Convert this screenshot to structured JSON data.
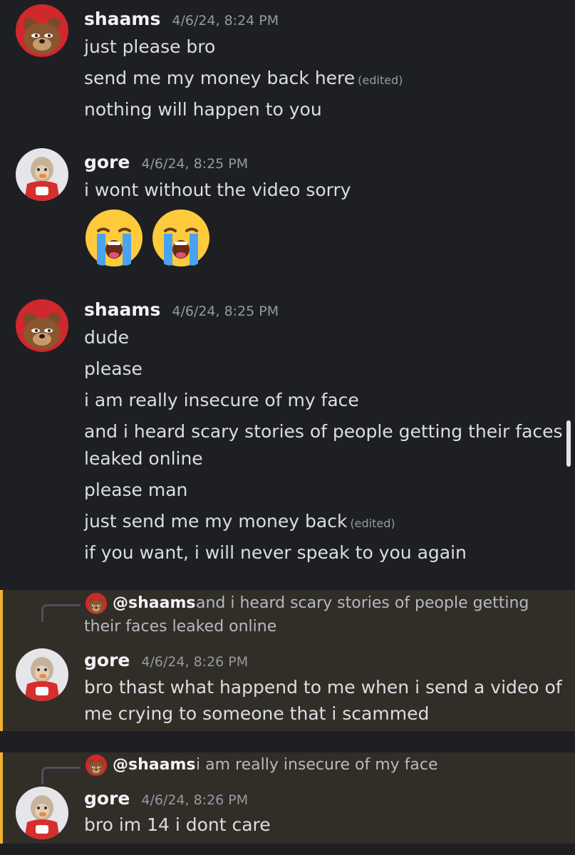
{
  "messages": {
    "m1": {
      "username": "shaams",
      "timestamp": "4/6/24, 8:24 PM",
      "lines": [
        "just please bro",
        "send me my money back here",
        "nothing will happen to you"
      ],
      "edited_label": "(edited)"
    },
    "m2": {
      "username": "gore",
      "timestamp": "4/6/24, 8:25 PM",
      "lines": [
        "i wont without the video sorry"
      ],
      "emojis": [
        "loudly-crying-face",
        "loudly-crying-face"
      ]
    },
    "m3": {
      "username": "shaams",
      "timestamp": "4/6/24, 8:25 PM",
      "lines": [
        "dude",
        "please",
        "i am really insecure of my face",
        "and i heard scary stories of people getting their faces",
        "leaked online",
        "please man",
        "just send me my  money  back",
        "if you want, i will never speak to you again"
      ],
      "edited_label": "(edited)"
    },
    "m4": {
      "reply_mention": "@shaams",
      "reply_text_1": "and i heard scary stories of people getting",
      "reply_text_2": "their faces leaked online",
      "username": "gore",
      "timestamp": "4/6/24, 8:26 PM",
      "lines": [
        "bro thast what happend to me when i send a video of",
        "me crying to someone that i scammed"
      ]
    },
    "m5": {
      "reply_mention": "@shaams",
      "reply_text": "i am really insecure of my face",
      "username": "gore",
      "timestamp": "4/6/24, 8:26 PM",
      "lines": [
        "bro im 14 i dont care"
      ]
    }
  },
  "colors": {
    "background": "#1e1f22",
    "highlight": "#312d27",
    "highlight_bar": "#f0b232"
  }
}
